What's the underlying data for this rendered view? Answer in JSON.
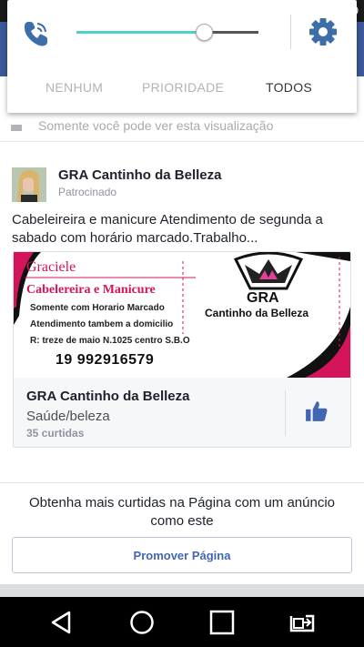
{
  "status_bar": {
    "time": "9"
  },
  "quick_settings": {
    "volume_percent": 70,
    "tabs": [
      {
        "label": "NENHUM",
        "active": false
      },
      {
        "label": "PRIORIDADE",
        "active": false
      },
      {
        "label": "TODOS",
        "active": true
      }
    ],
    "accent_color": "#4dd0c8"
  },
  "privacy": {
    "text": "Somente você pode ver esta visualização"
  },
  "post": {
    "page_name": "GRA Cantinho da Belleza",
    "sponsored_label": "Patrocinado",
    "text": "Cabeleireira e manicure Atendimento de segunda a sabado com horário marcado.Trabalho...",
    "card": {
      "image_text": {
        "name": "Graciele",
        "title": "Cabelereira e Manicure",
        "line1": "Somente com Horario Marcado",
        "line2": "Atendimento tambem a domicilio",
        "line3": "R: treze de maio N.1025 centro S.B.O",
        "phone": "19 992916579",
        "brand": "GRA",
        "brand_sub": "Cantinho da Belleza"
      },
      "page_name": "GRA Cantinho da Belleza",
      "category": "Saúde/beleza",
      "likes": "35 curtidas"
    }
  },
  "promote": {
    "text": "Obtenha mais curtidas na Página com um anúncio como este",
    "button_label": "Promover Página"
  },
  "colors": {
    "fb_blue": "#3b5998",
    "button_blue": "#4267b2",
    "like_blue": "#4267b2",
    "magenta": "#d4145a"
  },
  "icons": [
    "phone-ringing-icon",
    "gear-icon",
    "lock-icon",
    "thumbs-up-icon",
    "back-icon",
    "home-icon",
    "recents-icon",
    "screen-cast-icon"
  ]
}
